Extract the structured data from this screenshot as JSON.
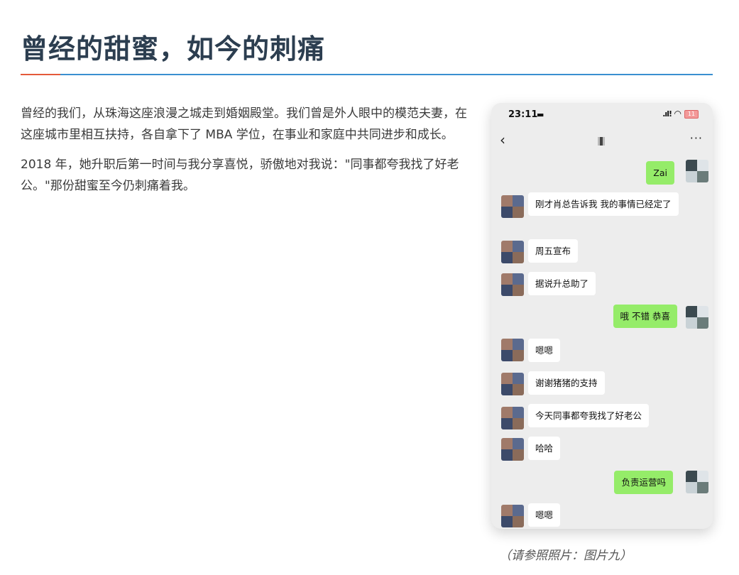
{
  "article": {
    "title": "曾经的甜蜜，如今的刺痛",
    "paragraphs": [
      "曾经的我们，从珠海这座浪漫之城走到婚姻殿堂。我们曾是外人眼中的模范夫妻，在这座城市里相互扶持，各自拿下了 MBA 学位，在事业和家庭中共同进步和成长。",
      "2018 年，她升职后第一时间与我分享喜悦，骄傲地对我说：\"同事都夸我找了好老公。\"那份甜蜜至今仍刺痛着我。"
    ],
    "caption": "（请参照照片：图片九）"
  },
  "phone": {
    "time": "23:11",
    "battery": "11",
    "back_icon": "chevron-left-icon",
    "more_label": "···",
    "messages": [
      {
        "side": "out",
        "text": "Zai"
      },
      {
        "side": "in",
        "text": "刚才肖总告诉我 我的事情已经定了"
      },
      {
        "side": "in",
        "text": "周五宣布"
      },
      {
        "side": "in",
        "text": "据说升总助了"
      },
      {
        "side": "out",
        "text": "哦 不错 恭喜"
      },
      {
        "side": "in",
        "text": "嗯嗯"
      },
      {
        "side": "in",
        "text": "谢谢猪猪的支持"
      },
      {
        "side": "in",
        "text": "今天同事都夸我找了好老公"
      },
      {
        "side": "in",
        "text": "哈哈"
      },
      {
        "side": "out",
        "text": "负责运营吗"
      },
      {
        "side": "in",
        "text": "嗯嗯"
      }
    ]
  },
  "colors": {
    "title": "#2c3e50",
    "divider": "#3a8fd0",
    "divider_accent": "#e45a3a",
    "bubble_out": "#95ec69",
    "bubble_in": "#ffffff",
    "chat_bg": "#ededed"
  }
}
